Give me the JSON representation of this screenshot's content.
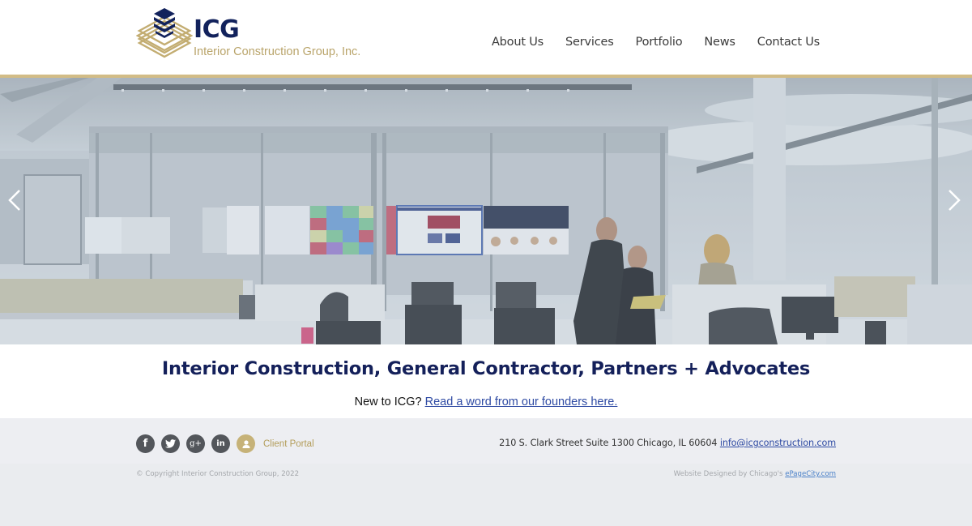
{
  "header": {
    "logo": {
      "abbreviation": "ICG",
      "company_name": "Interior Construction Group, Inc."
    },
    "nav": [
      {
        "label": "About Us"
      },
      {
        "label": "Services"
      },
      {
        "label": "Portfolio"
      },
      {
        "label": "News"
      },
      {
        "label": "Contact Us"
      }
    ]
  },
  "hero": {
    "prev_icon": "chevron-left-icon",
    "next_icon": "chevron-right-icon",
    "image_description": "Open office interior with glass-walled meeting room, wall of display screens, and three people reviewing a yellow folder"
  },
  "main": {
    "tagline": "Interior Construction, General Contractor, Partners + Advocates",
    "intro_prefix": "New to ICG?",
    "intro_link": "Read a word from our founders here."
  },
  "footer": {
    "social": [
      {
        "name": "facebook",
        "glyph": "f"
      },
      {
        "name": "twitter",
        "glyph": "t"
      },
      {
        "name": "google-plus",
        "glyph": "g+"
      },
      {
        "name": "linkedin",
        "glyph": "in"
      }
    ],
    "client_portal_label": "Client Portal",
    "address": "210 S. Clark Street Suite 1300 Chicago, IL 60604",
    "email": "info@icgconstruction.com",
    "copyright": "© Copyright Interior Construction Group, 2022",
    "designed_by_prefix": "Website Designed by Chicago's",
    "designed_by_link": "ePageCity.com"
  },
  "colors": {
    "brand_navy": "#12225c",
    "brand_gold": "#b9a46a",
    "gold_band": "#d2bc86",
    "link_blue": "#2e4aa3",
    "footer_bg": "#edeef2"
  }
}
